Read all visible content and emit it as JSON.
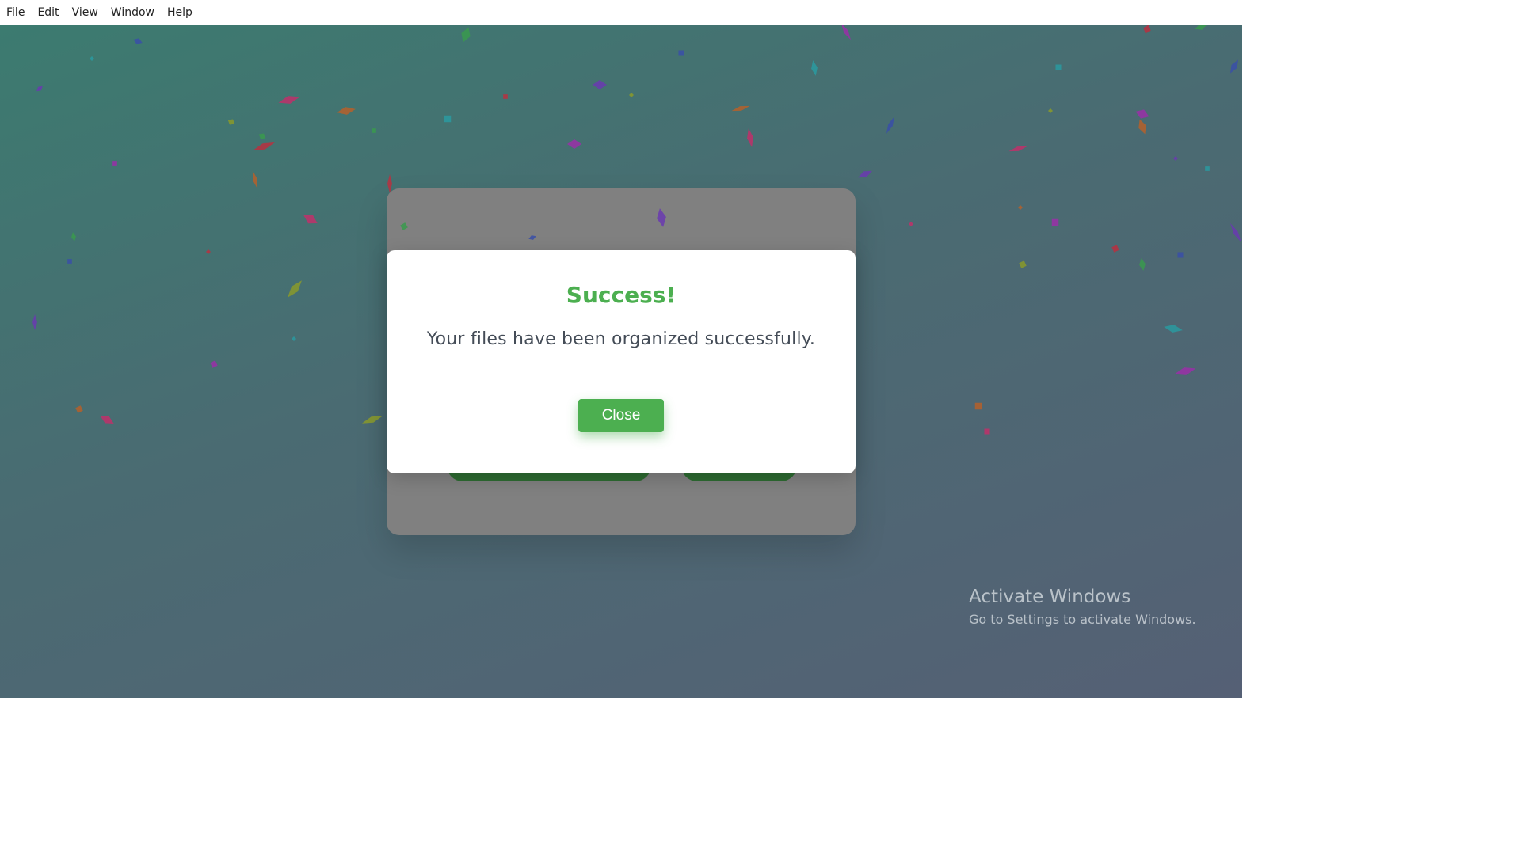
{
  "menu": {
    "items": [
      "File",
      "Edit",
      "View",
      "Window",
      "Help"
    ]
  },
  "modal": {
    "title": "Success!",
    "message": "Your files have been organized successfully.",
    "close_label": "Close"
  },
  "watermark": {
    "title": "Activate Windows",
    "subtitle": "Go to Settings to activate Windows."
  },
  "colors": {
    "accent": "#4caf50",
    "backdrop_start": "#3c7b70",
    "backdrop_end": "#556075",
    "confetti": [
      "#c0306a",
      "#3a4fa8",
      "#b5602a",
      "#3a9a4e",
      "#9a2fa8",
      "#b83040",
      "#2a9aa0",
      "#8a9a2a",
      "#6a3ab0"
    ]
  }
}
